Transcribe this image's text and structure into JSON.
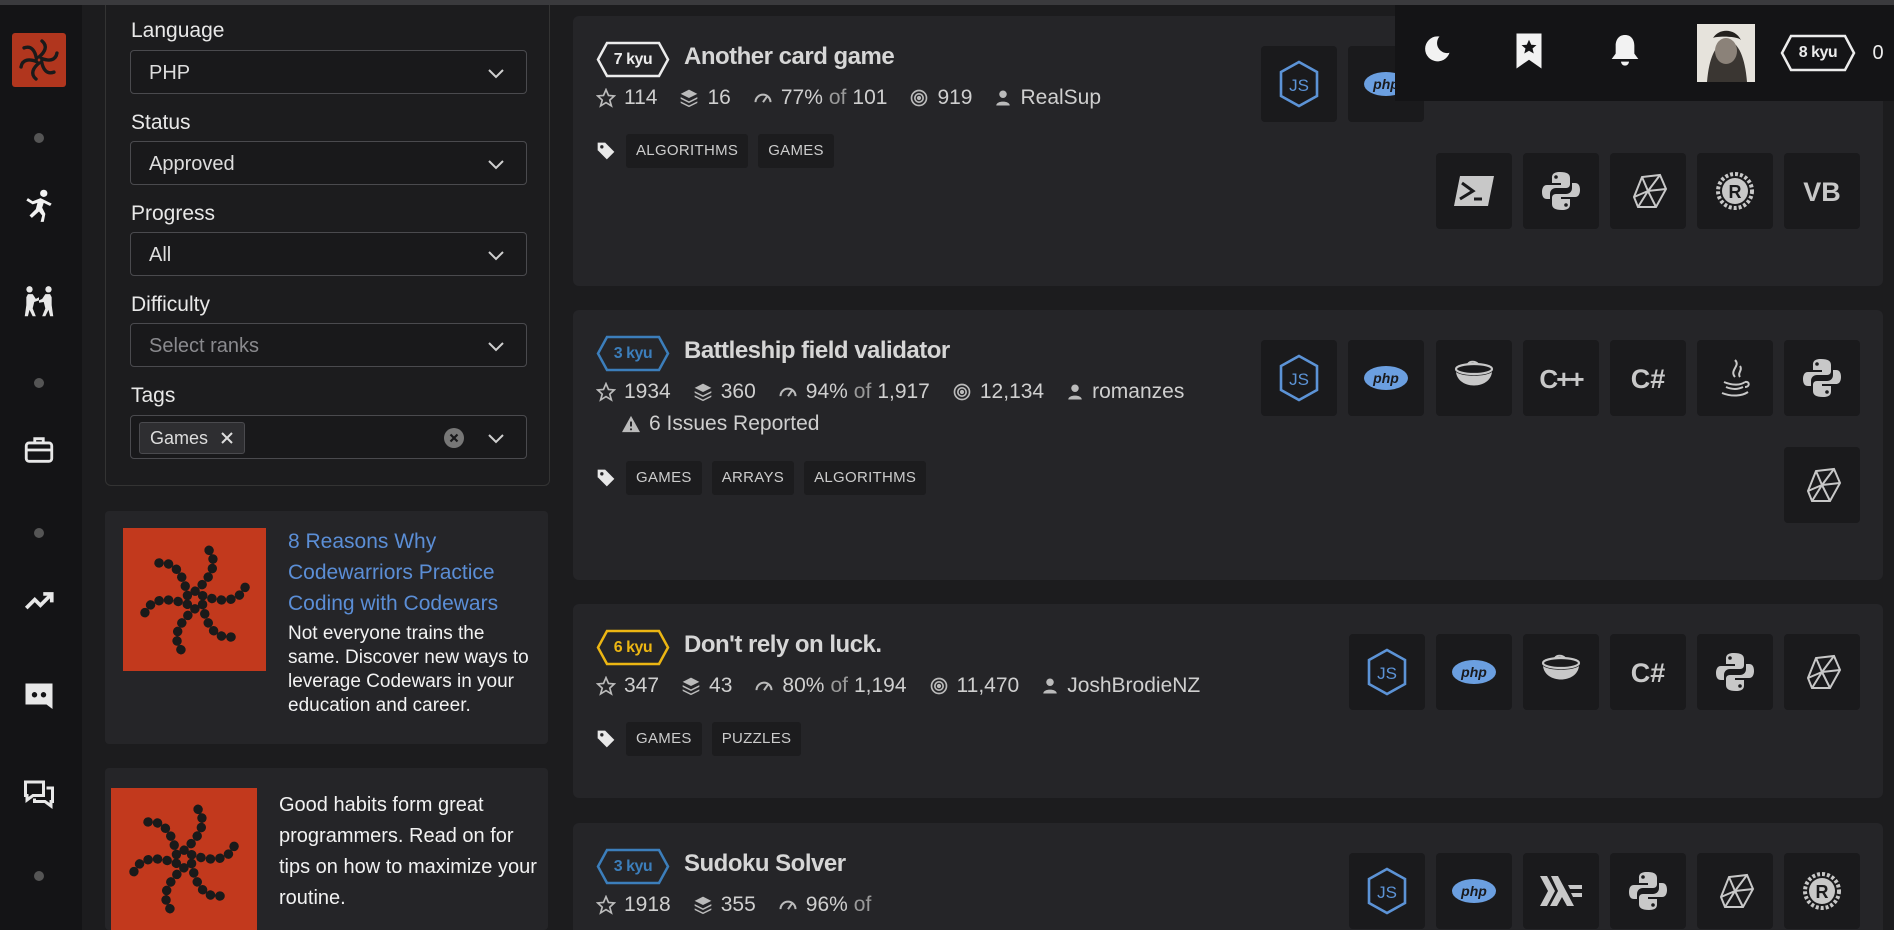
{
  "filters": {
    "language": {
      "label": "Language",
      "value": "PHP"
    },
    "status": {
      "label": "Status",
      "value": "Approved"
    },
    "progress": {
      "label": "Progress",
      "value": "All"
    },
    "difficulty": {
      "label": "Difficulty",
      "placeholder": "Select ranks"
    },
    "tags": {
      "label": "Tags",
      "chips": [
        "Games"
      ]
    }
  },
  "promos": [
    {
      "title": "8 Reasons Why Codewarriors Practice Coding with Codewars",
      "body": "Not everyone trains the same. Discover new ways to leverage Codewars in your education and career."
    },
    {
      "body": "Good habits form great programmers. Read on for tips on how to maximize your routine."
    }
  ],
  "topbar": {
    "rank": "8 kyu",
    "honor": "0"
  },
  "colors": {
    "kyu7": "#ececec",
    "kyu3": "#3c7ebb",
    "kyu6": "#ecb613",
    "brand": "#b1361e",
    "link": "#5b8ed6"
  },
  "katas": [
    {
      "rank": "7 kyu",
      "title": "Another card game",
      "stars": "114",
      "collections": "16",
      "satisfaction": "77%",
      "of": "of",
      "votes": "101",
      "completed": "919",
      "author": "RealSup",
      "tags": [
        "ALGORITHMS",
        "GAMES"
      ],
      "languages": [
        "javascript",
        "php",
        "powershell",
        "python",
        "ruby",
        "rust",
        "vb"
      ]
    },
    {
      "rank": "3 kyu",
      "title": "Battleship field validator",
      "stars": "1934",
      "collections": "360",
      "satisfaction": "94%",
      "of": "of",
      "votes": "1,917",
      "completed": "12,134",
      "author": "romanzes",
      "issues": "6 Issues Reported",
      "tags": [
        "GAMES",
        "ARRAYS",
        "ALGORITHMS"
      ],
      "languages": [
        "javascript",
        "php",
        "coffeescript",
        "cpp",
        "csharp",
        "java",
        "python",
        "ruby"
      ]
    },
    {
      "rank": "6 kyu",
      "title": "Don't rely on luck.",
      "stars": "347",
      "collections": "43",
      "satisfaction": "80%",
      "of": "of",
      "votes": "1,194",
      "completed": "11,470",
      "author": "JoshBrodieNZ",
      "tags": [
        "GAMES",
        "PUZZLES"
      ],
      "languages": [
        "javascript",
        "php",
        "coffeescript",
        "csharp",
        "python",
        "ruby"
      ]
    },
    {
      "rank": "3 kyu",
      "title": "Sudoku Solver",
      "stars": "1918",
      "collections": "355",
      "satisfaction": "96%",
      "of": "of",
      "languages": [
        "javascript",
        "php",
        "haskell",
        "python",
        "ruby",
        "rust"
      ]
    }
  ]
}
